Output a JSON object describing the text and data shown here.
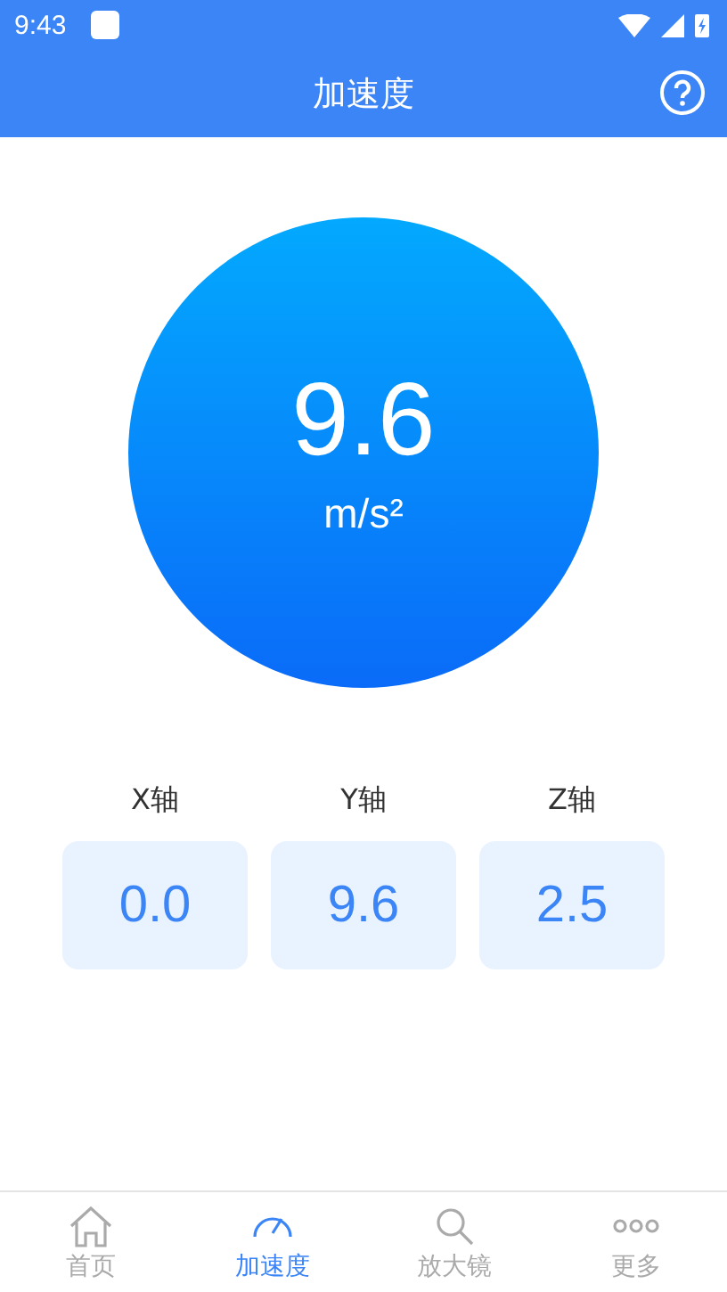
{
  "status_bar": {
    "time": "9:43"
  },
  "header": {
    "title": "加速度"
  },
  "gauge": {
    "value": "9.6",
    "unit": "m/s²"
  },
  "axes": [
    {
      "label": "X轴",
      "value": "0.0"
    },
    {
      "label": "Y轴",
      "value": "9.6"
    },
    {
      "label": "Z轴",
      "value": "2.5"
    }
  ],
  "bottom_nav": [
    {
      "label": "首页",
      "kind": "home",
      "selected": false
    },
    {
      "label": "加速度",
      "kind": "gauge",
      "selected": true
    },
    {
      "label": "放大镜",
      "kind": "magnifier",
      "selected": false
    },
    {
      "label": "更多",
      "kind": "more",
      "selected": false
    }
  ]
}
